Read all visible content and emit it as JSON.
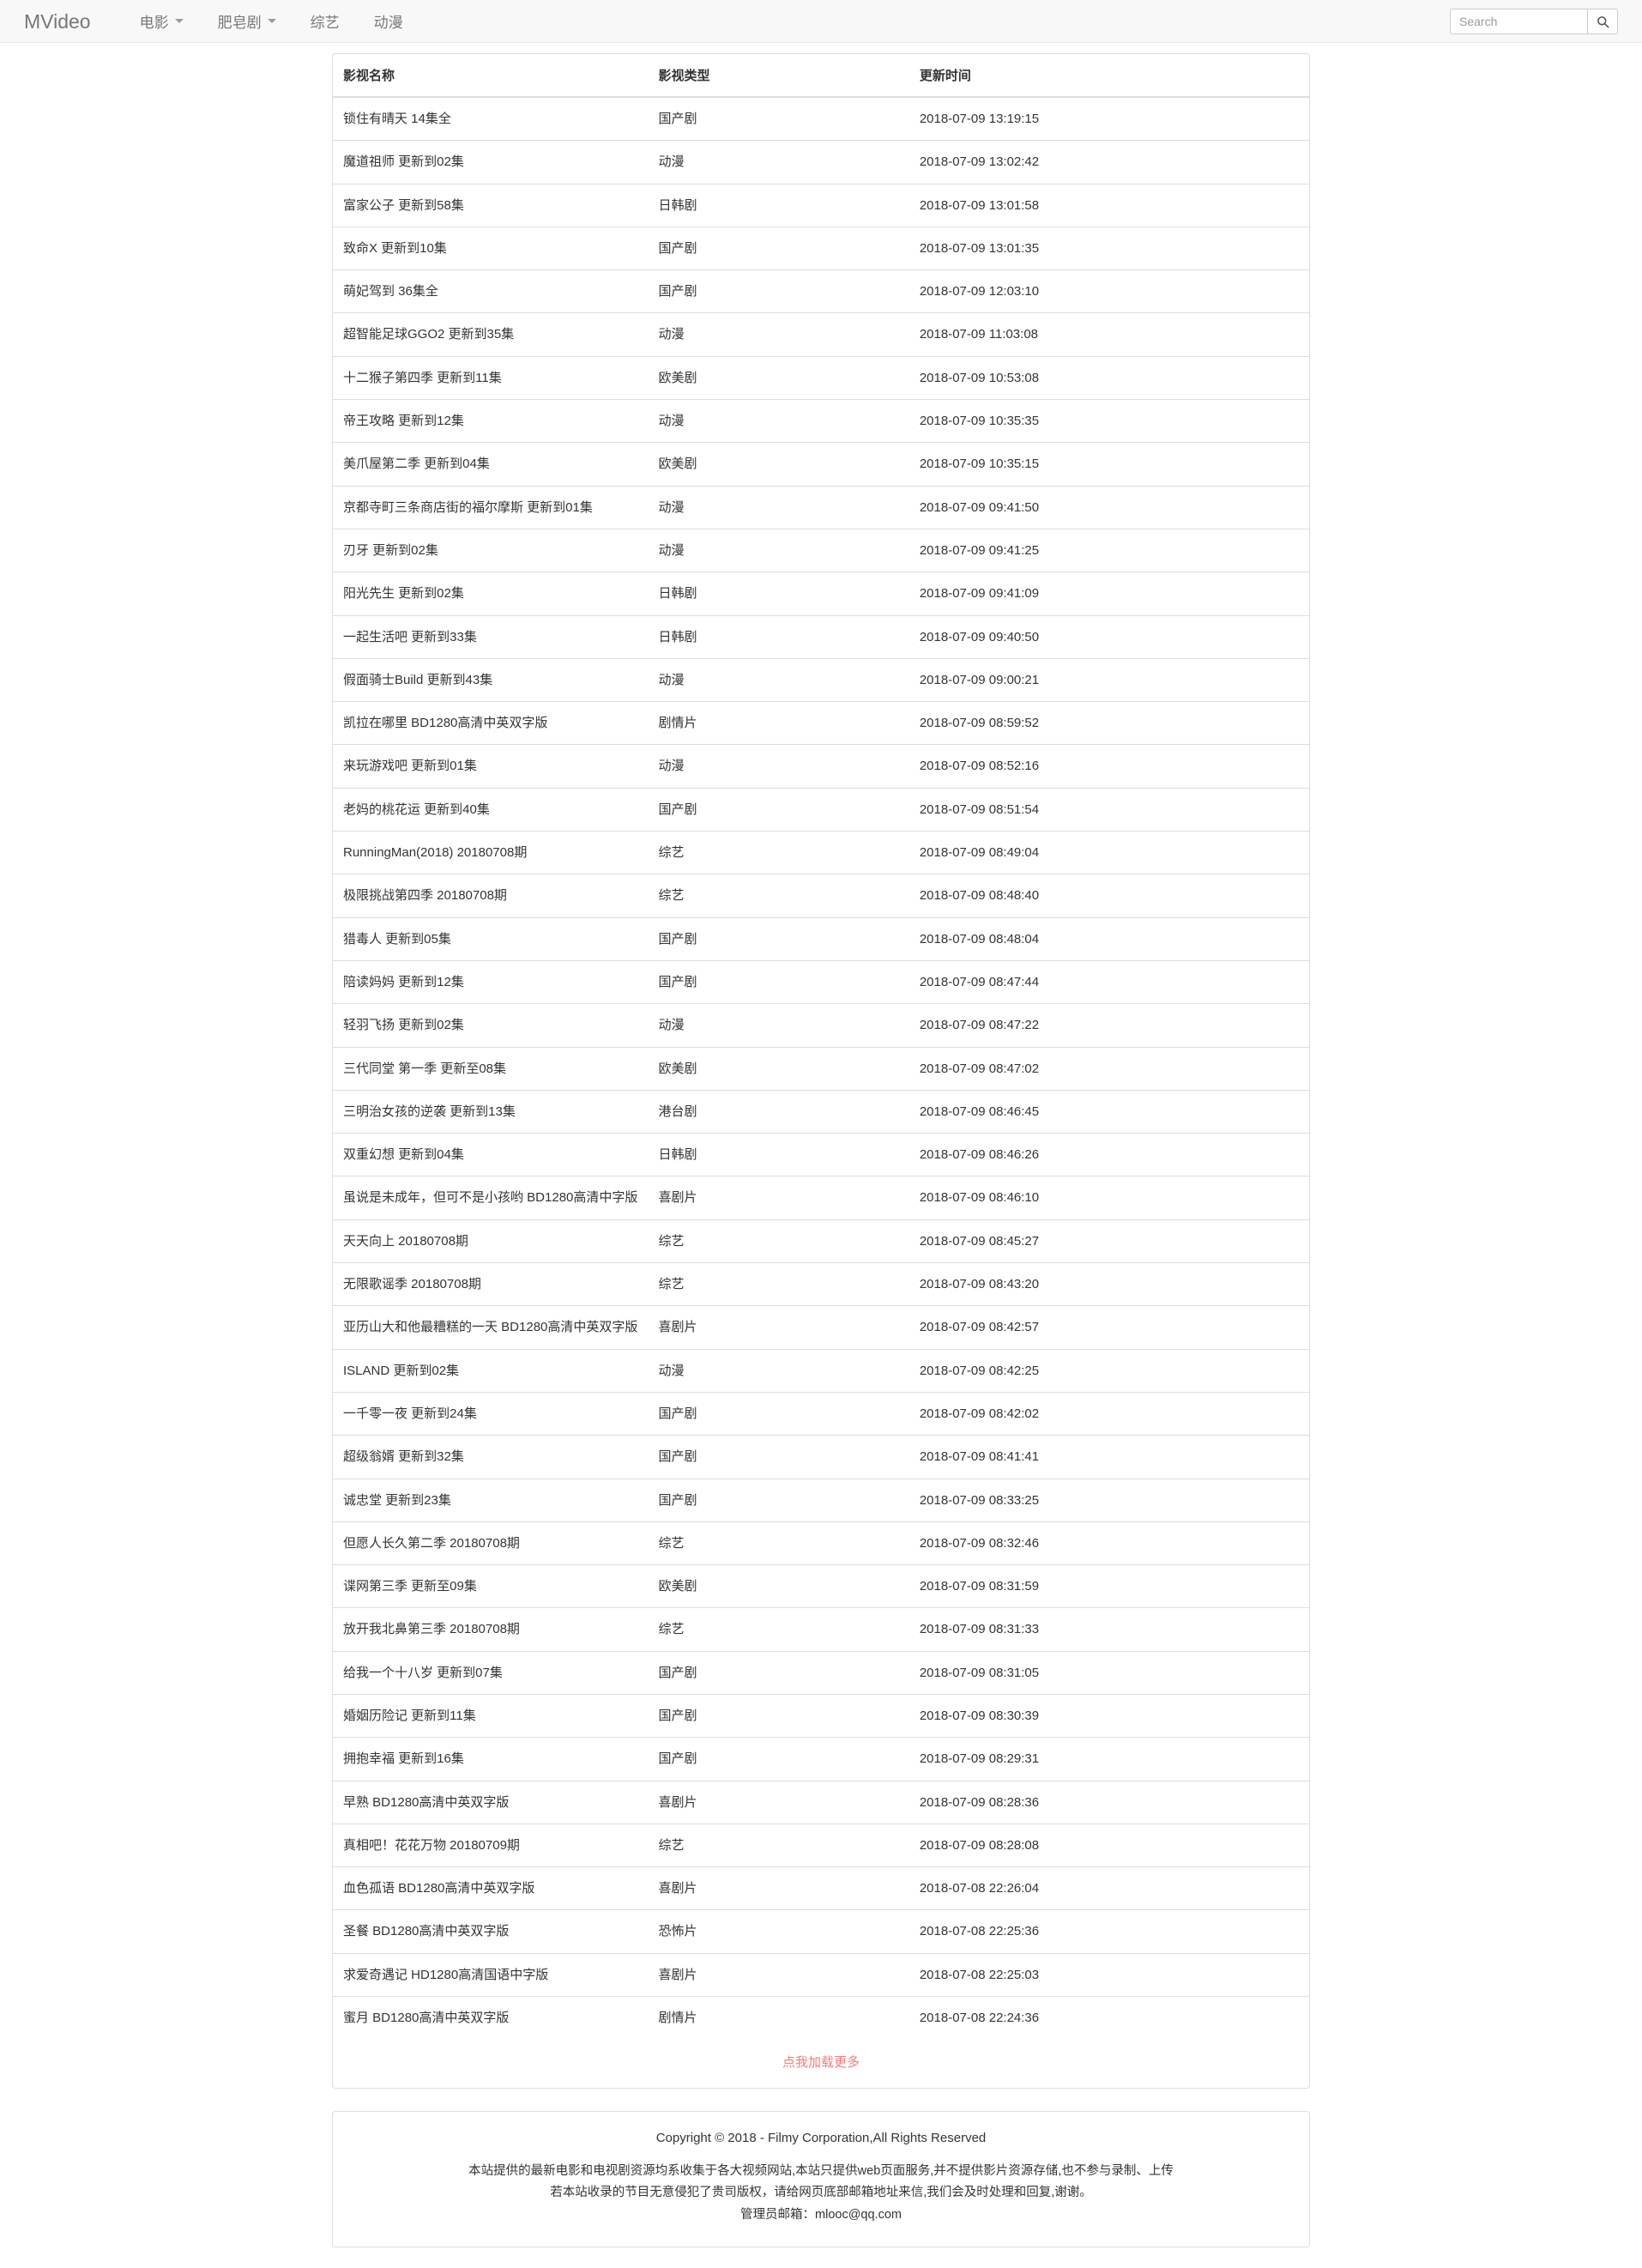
{
  "navbar": {
    "brand": "MVideo",
    "items": [
      {
        "label": "电影",
        "has_caret": true,
        "name": "nav-item-movies"
      },
      {
        "label": "肥皂剧",
        "has_caret": true,
        "name": "nav-item-soap-operas"
      },
      {
        "label": "综艺",
        "has_caret": false,
        "name": "nav-item-variety"
      },
      {
        "label": "动漫",
        "has_caret": false,
        "name": "nav-item-anime"
      }
    ],
    "search": {
      "placeholder": "Search",
      "value": "",
      "icon": "search-icon"
    }
  },
  "table": {
    "columns": [
      "影视名称",
      "影视类型",
      "更新时间"
    ],
    "rows": [
      [
        "锁住有晴天 14集全",
        "国产剧",
        "2018-07-09 13:19:15"
      ],
      [
        "魔道祖师 更新到02集",
        "动漫",
        "2018-07-09 13:02:42"
      ],
      [
        "富家公子 更新到58集",
        "日韩剧",
        "2018-07-09 13:01:58"
      ],
      [
        "致命X 更新到10集",
        "国产剧",
        "2018-07-09 13:01:35"
      ],
      [
        "萌妃驾到 36集全",
        "国产剧",
        "2018-07-09 12:03:10"
      ],
      [
        "超智能足球GGO2 更新到35集",
        "动漫",
        "2018-07-09 11:03:08"
      ],
      [
        "十二猴子第四季 更新到11集",
        "欧美剧",
        "2018-07-09 10:53:08"
      ],
      [
        "帝王攻略 更新到12集",
        "动漫",
        "2018-07-09 10:35:35"
      ],
      [
        "美爪屋第二季 更新到04集",
        "欧美剧",
        "2018-07-09 10:35:15"
      ],
      [
        "京都寺町三条商店街的福尔摩斯 更新到01集",
        "动漫",
        "2018-07-09 09:41:50"
      ],
      [
        "刃牙 更新到02集",
        "动漫",
        "2018-07-09 09:41:25"
      ],
      [
        "阳光先生 更新到02集",
        "日韩剧",
        "2018-07-09 09:41:09"
      ],
      [
        "一起生活吧 更新到33集",
        "日韩剧",
        "2018-07-09 09:40:50"
      ],
      [
        "假面骑士Build 更新到43集",
        "动漫",
        "2018-07-09 09:00:21"
      ],
      [
        "凯拉在哪里 BD1280高清中英双字版",
        "剧情片",
        "2018-07-09 08:59:52"
      ],
      [
        "来玩游戏吧 更新到01集",
        "动漫",
        "2018-07-09 08:52:16"
      ],
      [
        "老妈的桃花运 更新到40集",
        "国产剧",
        "2018-07-09 08:51:54"
      ],
      [
        "RunningMan(2018) 20180708期",
        "综艺",
        "2018-07-09 08:49:04"
      ],
      [
        "极限挑战第四季 20180708期",
        "综艺",
        "2018-07-09 08:48:40"
      ],
      [
        "猎毒人 更新到05集",
        "国产剧",
        "2018-07-09 08:48:04"
      ],
      [
        "陪读妈妈 更新到12集",
        "国产剧",
        "2018-07-09 08:47:44"
      ],
      [
        "轻羽飞扬 更新到02集",
        "动漫",
        "2018-07-09 08:47:22"
      ],
      [
        "三代同堂 第一季 更新至08集",
        "欧美剧",
        "2018-07-09 08:47:02"
      ],
      [
        "三明治女孩的逆袭 更新到13集",
        "港台剧",
        "2018-07-09 08:46:45"
      ],
      [
        "双重幻想 更新到04集",
        "日韩剧",
        "2018-07-09 08:46:26"
      ],
      [
        "虽说是未成年，但可不是小孩哟 BD1280高清中字版",
        "喜剧片",
        "2018-07-09 08:46:10"
      ],
      [
        "天天向上 20180708期",
        "综艺",
        "2018-07-09 08:45:27"
      ],
      [
        "无限歌谣季 20180708期",
        "综艺",
        "2018-07-09 08:43:20"
      ],
      [
        "亚历山大和他最糟糕的一天 BD1280高清中英双字版",
        "喜剧片",
        "2018-07-09 08:42:57"
      ],
      [
        "ISLAND 更新到02集",
        "动漫",
        "2018-07-09 08:42:25"
      ],
      [
        "一千零一夜 更新到24集",
        "国产剧",
        "2018-07-09 08:42:02"
      ],
      [
        "超级翁婿 更新到32集",
        "国产剧",
        "2018-07-09 08:41:41"
      ],
      [
        "诚忠堂 更新到23集",
        "国产剧",
        "2018-07-09 08:33:25"
      ],
      [
        "但愿人长久第二季 20180708期",
        "综艺",
        "2018-07-09 08:32:46"
      ],
      [
        "谍网第三季 更新至09集",
        "欧美剧",
        "2018-07-09 08:31:59"
      ],
      [
        "放开我北鼻第三季 20180708期",
        "综艺",
        "2018-07-09 08:31:33"
      ],
      [
        "给我一个十八岁 更新到07集",
        "国产剧",
        "2018-07-09 08:31:05"
      ],
      [
        "婚姻历险记 更新到11集",
        "国产剧",
        "2018-07-09 08:30:39"
      ],
      [
        "拥抱幸福 更新到16集",
        "国产剧",
        "2018-07-09 08:29:31"
      ],
      [
        "早熟 BD1280高清中英双字版",
        "喜剧片",
        "2018-07-09 08:28:36"
      ],
      [
        "真相吧！花花万物 20180709期",
        "综艺",
        "2018-07-09 08:28:08"
      ],
      [
        "血色孤语 BD1280高清中英双字版",
        "喜剧片",
        "2018-07-08 22:26:04"
      ],
      [
        "圣餐 BD1280高清中英双字版",
        "恐怖片",
        "2018-07-08 22:25:36"
      ],
      [
        "求爱奇遇记 HD1280高清国语中字版",
        "喜剧片",
        "2018-07-08 22:25:03"
      ],
      [
        "蜜月 BD1280高清中英双字版",
        "剧情片",
        "2018-07-08 22:24:36"
      ]
    ]
  },
  "load_more": {
    "label": "点我加载更多",
    "color": "#f87c7c"
  },
  "footer": {
    "copyright": "Copyright © 2018 - Filmy Corporation,All Rights Reserved",
    "disclaimer_line1": "本站提供的最新电影和电视剧资源均系收集于各大视频网站,本站只提供web页面服务,并不提供影片资源存储,也不参与录制、上传",
    "disclaimer_line2": "若本站收录的节目无意侵犯了贵司版权，请给网页底部邮箱地址来信,我们会及时处理和回复,谢谢。",
    "admin_email": "管理员邮箱：mlooc@qq.com"
  }
}
